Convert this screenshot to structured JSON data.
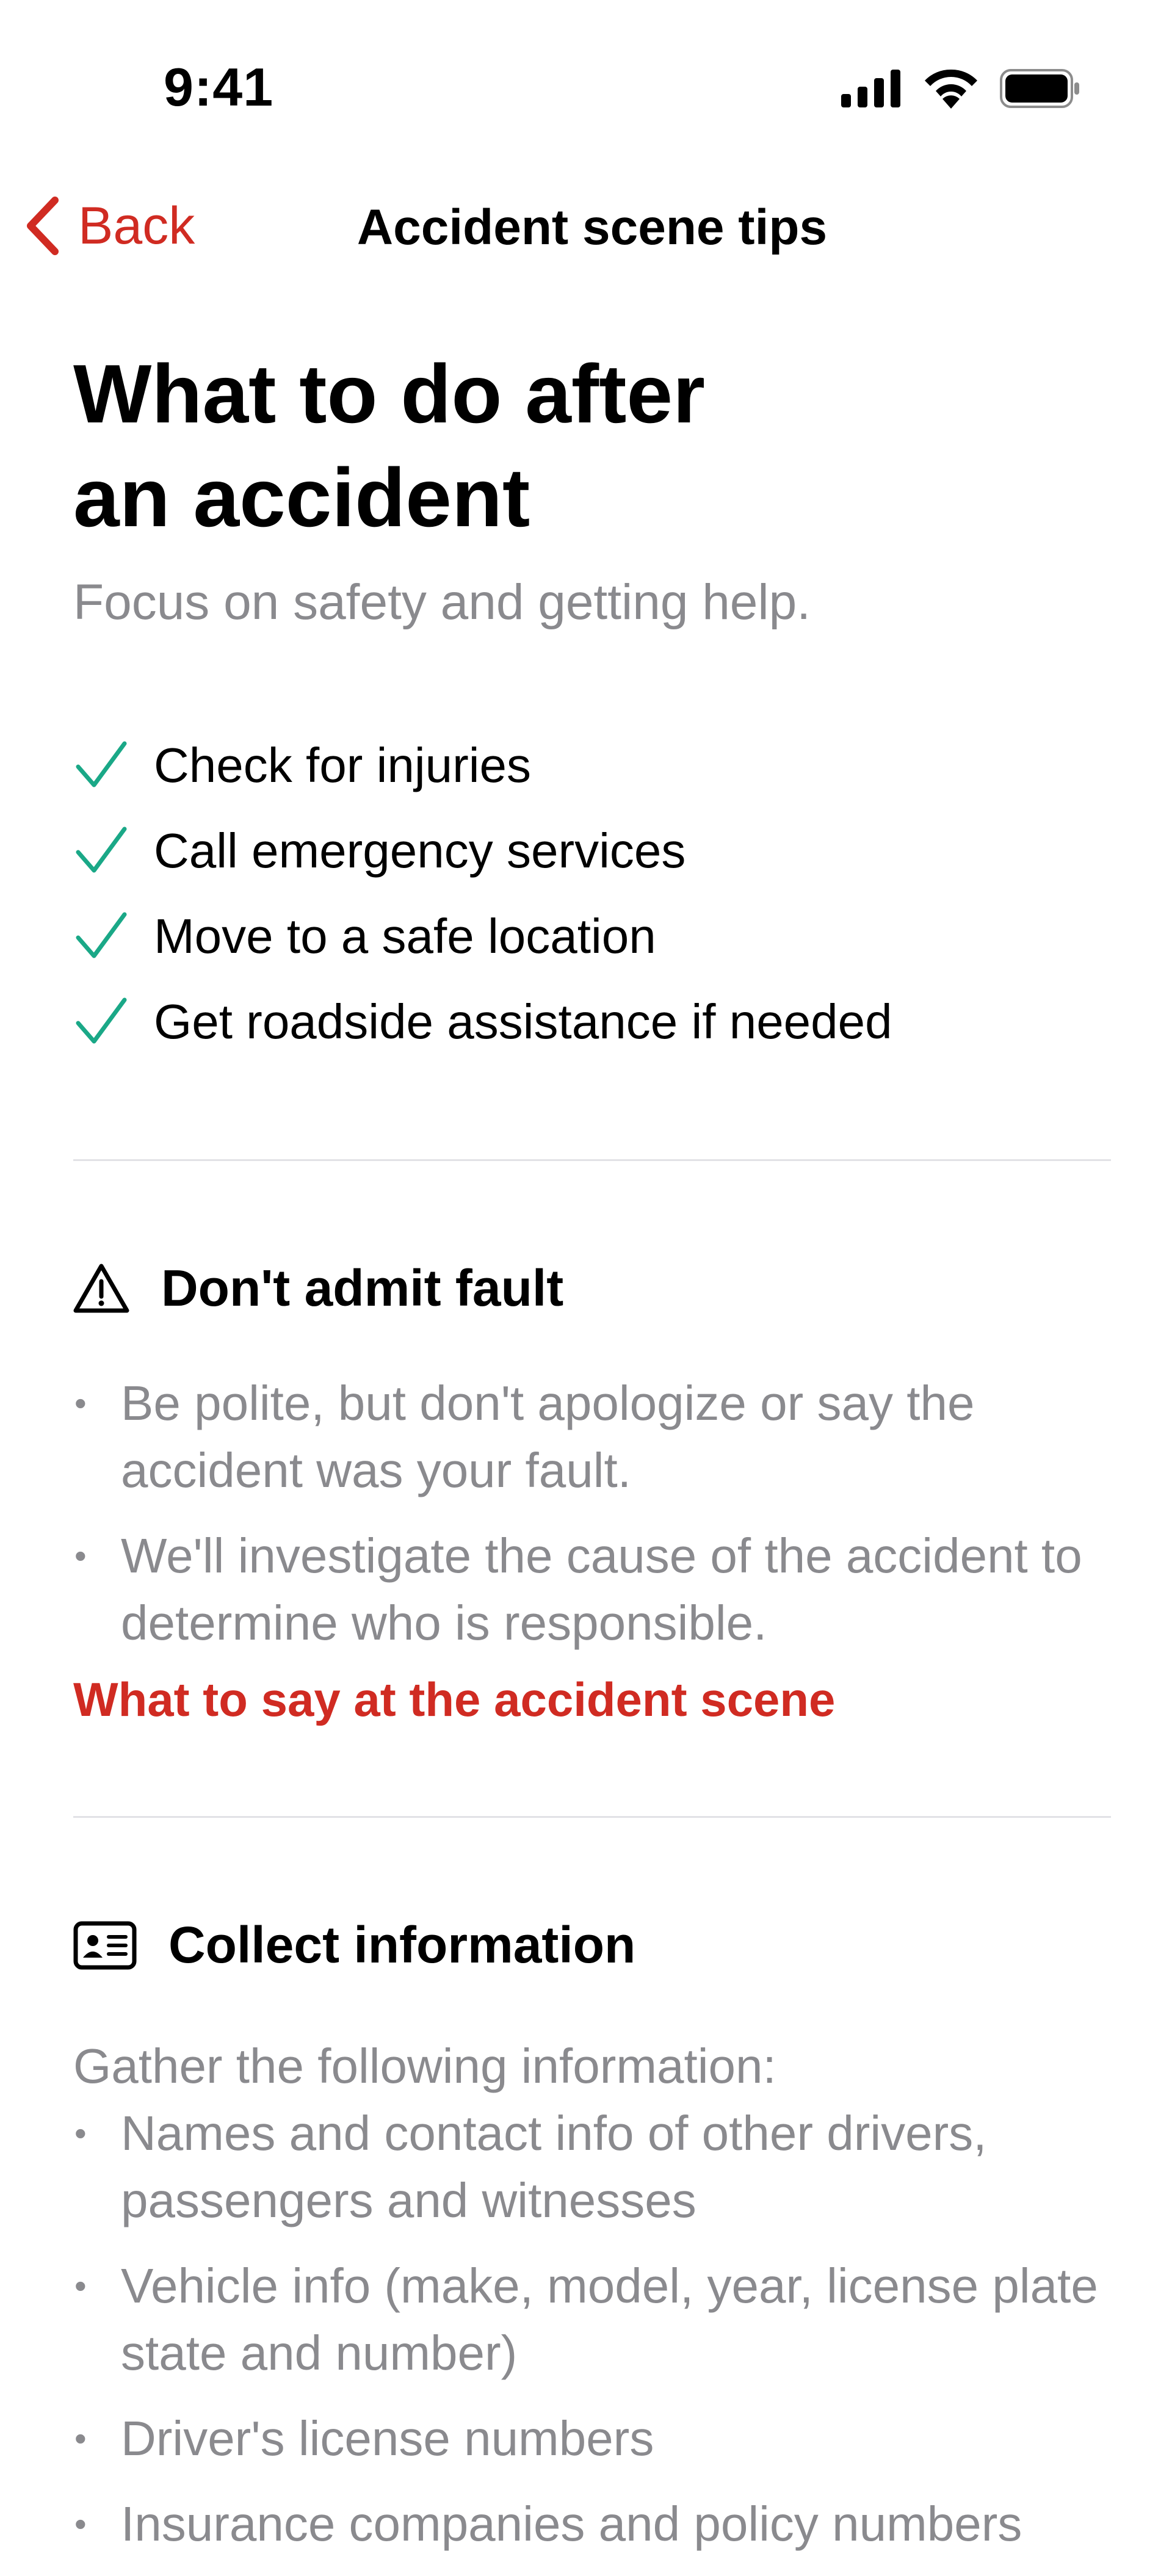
{
  "status_bar": {
    "time": "9:41"
  },
  "nav": {
    "back_label": "Back",
    "title": "Accident scene tips"
  },
  "intro": {
    "heading_line1": "What to do after",
    "heading_line2": "an accident",
    "subtitle": "Focus on safety and getting help."
  },
  "checklist": [
    "Check for injuries",
    "Call emergency services",
    "Move to a safe location",
    "Get roadside assistance if needed"
  ],
  "fault_section": {
    "title": "Don't admit fault",
    "bullets": [
      "Be polite, but don't apologize or say the accident was your fault.",
      "We'll investigate the cause of the accident to determine who is responsible."
    ],
    "link": "What to say at the accident scene"
  },
  "collect_section": {
    "title": "Collect information",
    "intro": "Gather the following information:",
    "bullets": [
      "Names and contact info of other drivers, passengers and witnesses",
      "Vehicle info (make, model, year, license plate state and number)",
      "Driver's license numbers",
      "Insurance companies and policy numbers"
    ]
  },
  "colors": {
    "accent": "#d02b22",
    "check": "#1aa887",
    "secondary_text": "#8a8a8e"
  },
  "icons": {
    "back": "chevron-left-icon",
    "check": "checkmark-icon",
    "warning": "warning-triangle-icon",
    "id_card": "id-card-icon",
    "signal": "cellular-signal-icon",
    "wifi": "wifi-icon",
    "battery": "battery-icon"
  }
}
